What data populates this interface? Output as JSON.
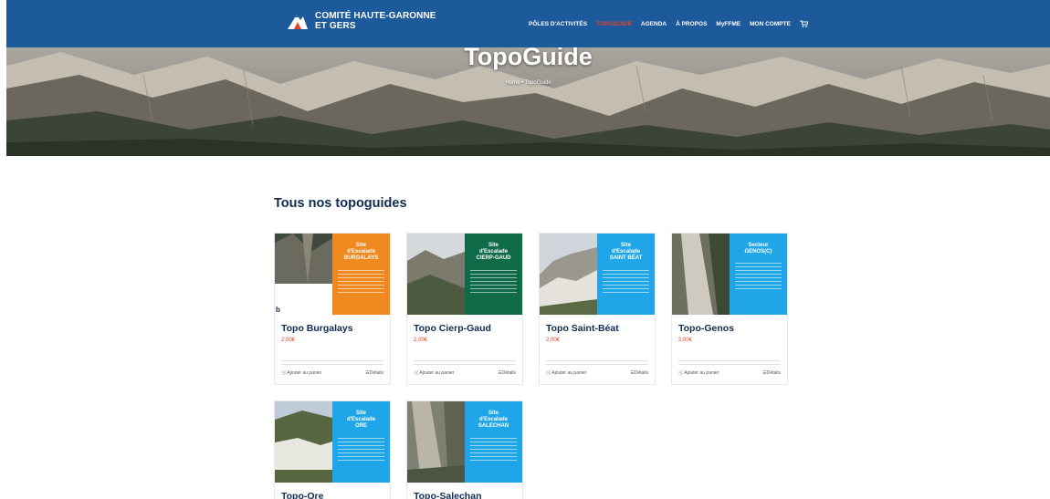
{
  "header": {
    "logo_line1": "COMITÉ HAUTE-GARONNE",
    "logo_line2": "ET GERS",
    "nav": [
      "PÔLES D'ACTIVITÉS",
      "TOPOGUIDE",
      "AGENDA",
      "À PROPOS",
      "MyFFME",
      "MON COMPTE"
    ],
    "active_nav": "TOPOGUIDE",
    "accent_color": "#e5412b",
    "bar_color": "#1c5a9c"
  },
  "hero": {
    "title": "TopoGuide",
    "breadcrumb": "Home • TopoGuide"
  },
  "section": {
    "title": "Tous nos topoguides"
  },
  "products": [
    {
      "name": "Topo Burgalays",
      "price": "2,00€",
      "panel": "Site\nd'Escalade\nBURGALAYS",
      "panel_color": "#f0891f",
      "add": "Ajouter au panier",
      "details": "Détails"
    },
    {
      "name": "Topo Cierp-Gaud",
      "price": "2,00€",
      "panel": "Site\nd'Escalade\nCIERP-GAUD",
      "panel_color": "#0f6a48",
      "add": "Ajouter au panier",
      "details": "Détails"
    },
    {
      "name": "Topo Saint-Béat",
      "price": "2,00€",
      "panel": "Site\nd'Escalade\nSAINT BÉAT",
      "panel_color": "#1fa6e8",
      "add": "Ajouter au panier",
      "details": "Détails"
    },
    {
      "name": "Topo-Genos",
      "price": "2,00€",
      "panel": "Secteur\nGENOS(C)",
      "panel_color": "#1fa6e8",
      "add": "Ajouter au panier",
      "details": "Détails"
    },
    {
      "name": "Topo-Ore",
      "price": "",
      "panel": "Site\nd'Escalade\nORE",
      "panel_color": "#1fa6e8",
      "add": "",
      "details": ""
    },
    {
      "name": "Topo-Salechan",
      "price": "",
      "panel": "Site\nd'Escalade\nSALECHAN",
      "panel_color": "#1fa6e8",
      "add": "",
      "details": ""
    }
  ]
}
